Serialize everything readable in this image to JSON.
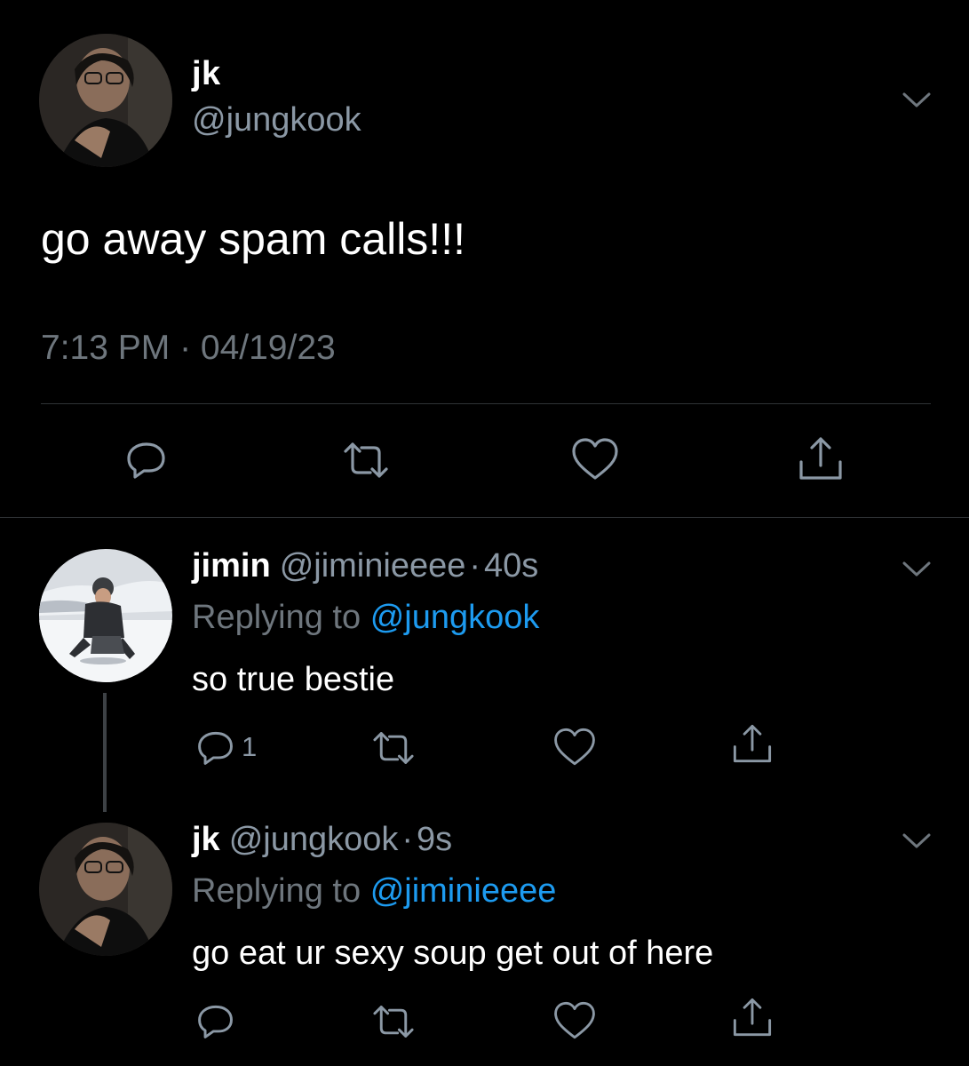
{
  "main_tweet": {
    "name": "jk",
    "handle": "@jungkook",
    "text": "go away spam calls!!!",
    "timestamp": "7:13 PM · 04/19/23",
    "icons": [
      "reply-icon",
      "retweet-icon",
      "like-icon",
      "share-icon",
      "chevron-down-icon"
    ]
  },
  "replies": [
    {
      "name": "jimin",
      "handle": "@jiminieeee",
      "dot": "·",
      "time": "40s",
      "replying_prefix": "Replying to",
      "replying_to": "@jungkook",
      "text": "so true bestie",
      "reply_count": "1"
    },
    {
      "name": "jk",
      "handle": "@jungkook",
      "dot": "·",
      "time": "9s",
      "replying_prefix": "Replying to",
      "replying_to": "@jiminieeee",
      "text": "go eat ur sexy soup get out of here",
      "reply_count": ""
    }
  ],
  "colors": {
    "background": "#000000",
    "text_primary": "#ffffff",
    "text_secondary": "#8b98a5",
    "mention": "#1d9bf0",
    "divider": "#2f3336"
  }
}
